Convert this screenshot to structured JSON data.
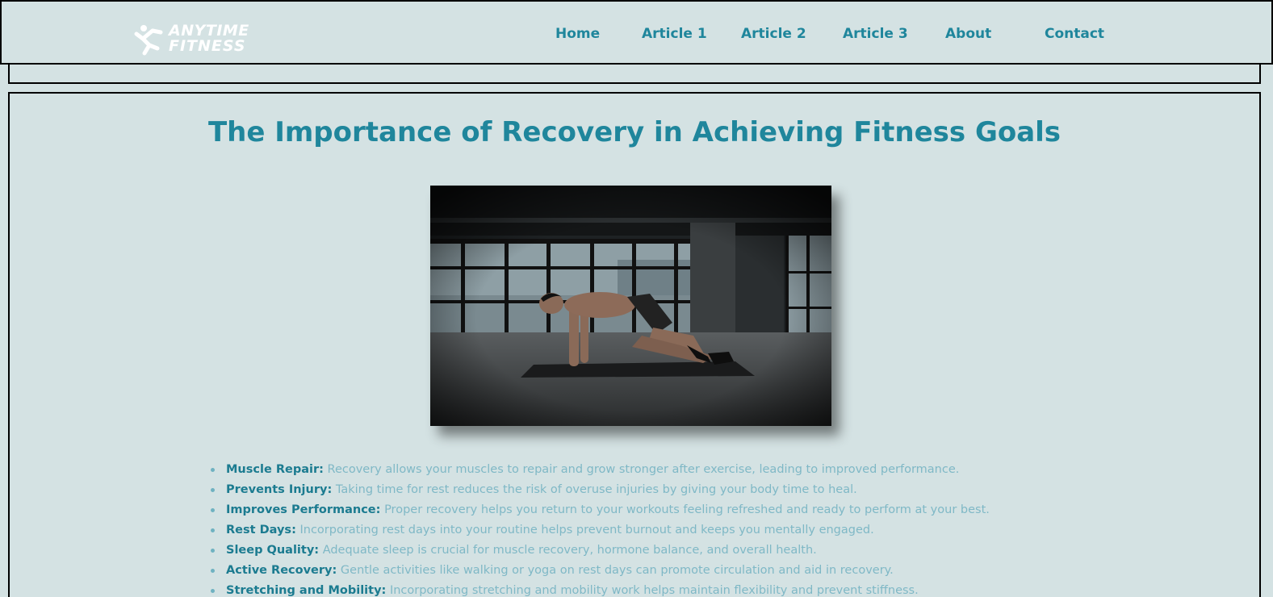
{
  "brand": {
    "line1": "ANYTIME",
    "line2": "FITNESS"
  },
  "nav": {
    "items": [
      {
        "label": "Home"
      },
      {
        "label": "Article 1"
      },
      {
        "label": "Article 2"
      },
      {
        "label": "Article 3"
      },
      {
        "label": "About"
      },
      {
        "label": "Contact"
      }
    ]
  },
  "article": {
    "title": "The Importance of Recovery in Achieving Fitness Goals",
    "image": {
      "icon": "hero-photo"
    },
    "points": [
      {
        "key": "Muscle Repair:",
        "text": "Recovery allows your muscles to repair and grow stronger after exercise, leading to improved performance."
      },
      {
        "key": "Prevents Injury:",
        "text": "Taking time for rest reduces the risk of overuse injuries by giving your body time to heal."
      },
      {
        "key": "Improves Performance:",
        "text": "Proper recovery helps you return to your workouts feeling refreshed and ready to perform at your best."
      },
      {
        "key": "Rest Days:",
        "text": "Incorporating rest days into your routine helps prevent burnout and keeps you mentally engaged."
      },
      {
        "key": "Sleep Quality:",
        "text": "Adequate sleep is crucial for muscle recovery, hormone balance, and overall health."
      },
      {
        "key": "Active Recovery:",
        "text": "Gentle activities like walking or yoga on rest days can promote circulation and aid in recovery."
      },
      {
        "key": "Stretching and Mobility:",
        "text": "Incorporating stretching and mobility work helps maintain flexibility and prevent stiffness."
      }
    ]
  },
  "colors": {
    "background": "#d4e2e3",
    "accent": "#1f869c",
    "muted_text": "#7fb8c6"
  }
}
